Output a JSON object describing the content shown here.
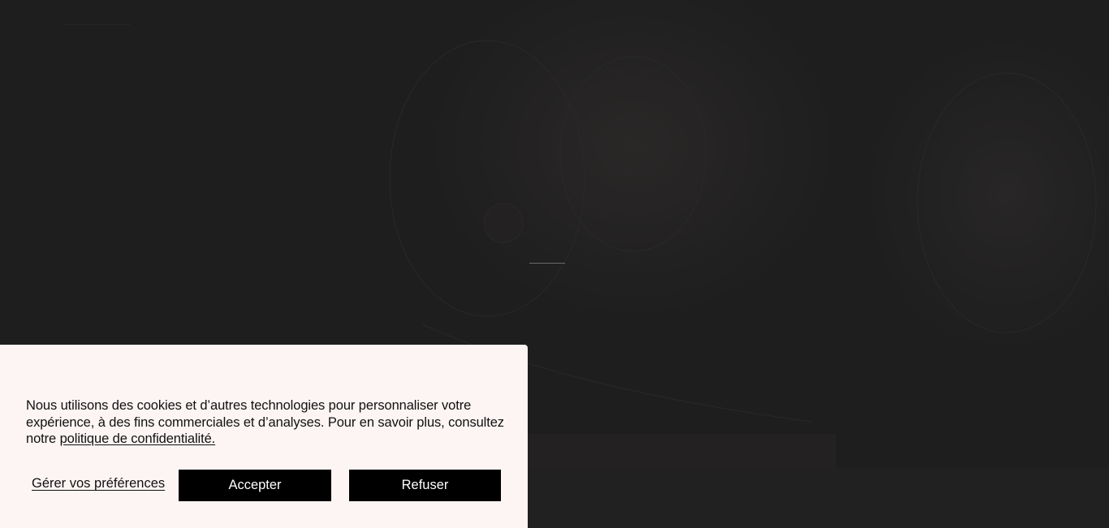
{
  "cookie_banner": {
    "message_prefix": "Nous utilisons des cookies et d’autres technologies pour personnaliser votre expérience, à des fins commerciales et d’analyses. Pour en savoir plus, consultez notre ",
    "privacy_link": "politique de confidentialité.",
    "manage_prefs": "Gérer vos préférences",
    "accept": "Accepter",
    "refuse": "Refuser"
  },
  "colors": {
    "banner_bg": "#fdf5f4",
    "button_bg": "#000000",
    "overlay_bg": "#1e1e1e"
  }
}
